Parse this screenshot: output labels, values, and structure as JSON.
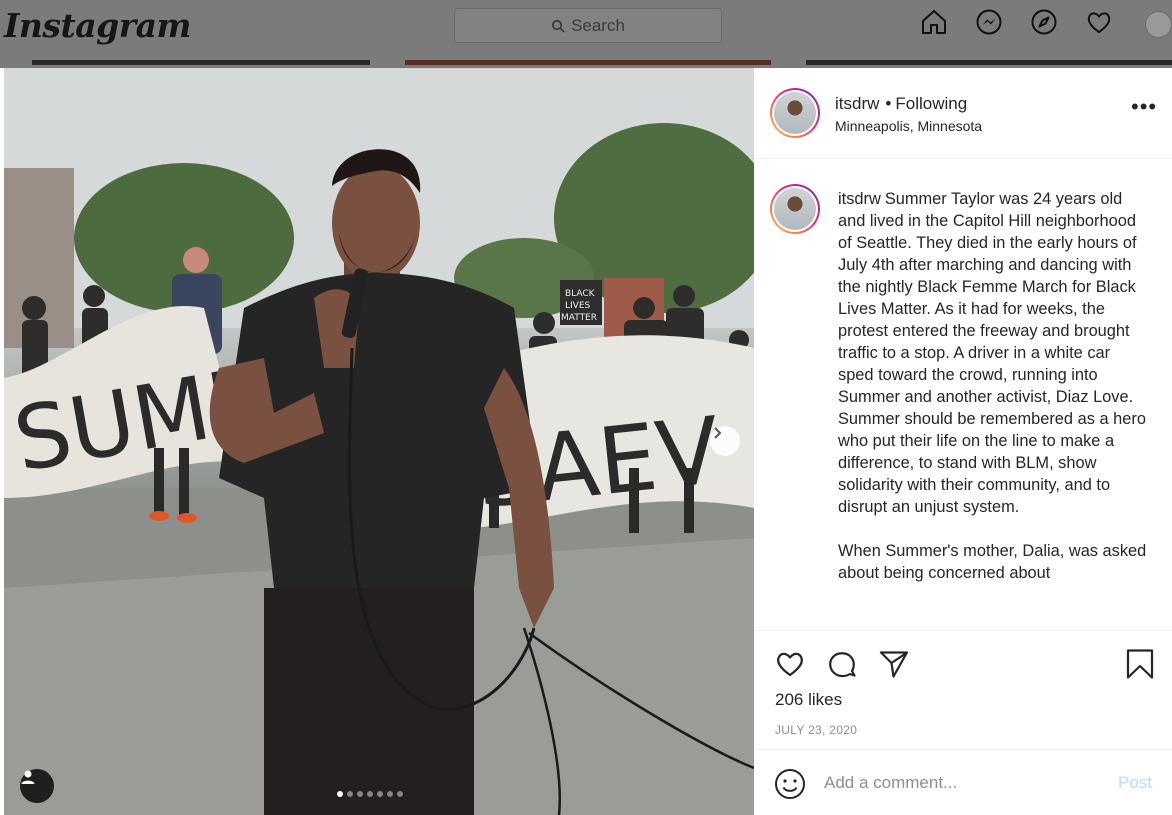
{
  "app": {
    "logo": "Instagram",
    "search_placeholder": "Search",
    "nav_icons": [
      "home-icon",
      "messenger-icon",
      "explore-icon",
      "heart-icon",
      "profile-avatar"
    ]
  },
  "post": {
    "username": "itsdrw",
    "separator": "•",
    "follow_status": "Following",
    "location": "Minneapolis, Minnesota",
    "more_label": "•••",
    "photo_sign_text": [
      "SUMM",
      "SAEV",
      "BLACK LIVES MATTER"
    ],
    "carousel": {
      "total": 7,
      "active": 1
    },
    "caption_p1": "Summer Taylor was 24 years old and lived in the Capitol Hill neighborhood of Seattle. They died in the early hours of July 4th after marching and dancing with the nightly Black Femme March for Black Lives Matter. As it had for weeks, the protest entered the freeway and brought traffic to a stop. A driver in a white car sped toward the crowd, running into Summer and another activist, Diaz Love. Summer should be remembered as a hero who put their life on the line to make a difference, to stand with BLM, show solidarity with their community, and to disrupt an unjust system.",
    "caption_p2": "When Summer's mother, Dalia, was asked about being concerned about",
    "likes": "206 likes",
    "date": "JULY 23, 2020",
    "comment_placeholder": "Add a comment...",
    "post_label": "Post"
  },
  "colors": {
    "overlay": "#7b7b7b",
    "text": "#262626",
    "muted": "#8e8e8e",
    "post_disabled": "#b2dffc",
    "story_ring": [
      "#f9ce34",
      "#ee2a7b",
      "#6228d7"
    ]
  }
}
